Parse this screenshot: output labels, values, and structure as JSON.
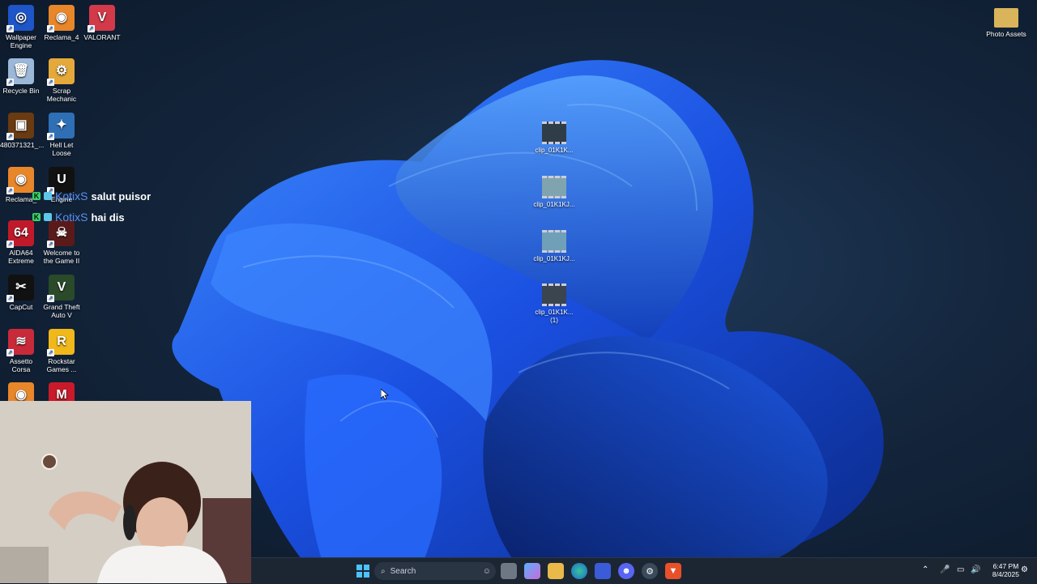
{
  "desktop_icons": [
    {
      "label": "Wallpaper Engine",
      "icon": "wallpaper-engine-icon",
      "color": "#1e55c8",
      "glyph": "◎"
    },
    {
      "label": "Reclama_4",
      "icon": "blender-icon",
      "color": "#e8862a",
      "glyph": "◉"
    },
    {
      "label": "VALORANT",
      "icon": "valorant-icon",
      "color": "#d23a4a",
      "glyph": "V"
    },
    {
      "label": "Recycle Bin",
      "icon": "recycle-bin-icon",
      "color": "#9bb8d8",
      "glyph": "🗑"
    },
    {
      "label": "Scrap Mechanic",
      "icon": "scrap-mechanic-icon",
      "color": "#e4a93a",
      "glyph": "⚙"
    },
    {
      "label": "480371321_...",
      "icon": "image-file-icon",
      "color": "#6a3a10",
      "glyph": "▣"
    },
    {
      "label": "Hell Let Loose",
      "icon": "hell-let-loose-icon",
      "color": "#2f6fb6",
      "glyph": "✦"
    },
    {
      "label": "Reclama_",
      "icon": "blender-icon",
      "color": "#e8862a",
      "glyph": "◉"
    },
    {
      "label": "Engine",
      "icon": "unreal-engine-icon",
      "color": "#111111",
      "glyph": "U"
    },
    {
      "label": "AIDA64 Extreme",
      "icon": "aida64-icon",
      "color": "#c01a2a",
      "glyph": "64"
    },
    {
      "label": "Welcome to the Game II",
      "icon": "skull-icon",
      "color": "#5a1a1a",
      "glyph": "☠"
    },
    {
      "label": "CapCut",
      "icon": "capcut-icon",
      "color": "#111111",
      "glyph": "✂"
    },
    {
      "label": "Grand Theft Auto V",
      "icon": "gta-v-icon",
      "color": "#2a4a2a",
      "glyph": "V"
    },
    {
      "label": "Assetto Corsa",
      "icon": "assetto-corsa-icon",
      "color": "#c82a3a",
      "glyph": "≋"
    },
    {
      "label": "Rockstar Games ...",
      "icon": "rockstar-icon",
      "color": "#f0b81a",
      "glyph": "R"
    },
    {
      "label": "",
      "icon": "blender-icon",
      "color": "#e8862a",
      "glyph": "◉"
    },
    {
      "label": "",
      "icon": "app-red-icon",
      "color": "#c81a2a",
      "glyph": "M"
    }
  ],
  "right_icon": {
    "label": "Photo Assets",
    "icon": "folder-icon"
  },
  "clips": [
    {
      "label": "clip_01K1K..."
    },
    {
      "label": "clip_01K1KJ..."
    },
    {
      "label": "clip_01K1KJ..."
    },
    {
      "label": "clip_01K1K...",
      "sub": "(1)"
    }
  ],
  "chat": [
    {
      "user": "KotixS",
      "message": "salut puisor"
    },
    {
      "user": "KotixS",
      "message": "hai dis"
    }
  ],
  "taskbar": {
    "search_label": "Search",
    "clock_time": "6:47 PM",
    "clock_date": "8/4/2025"
  }
}
